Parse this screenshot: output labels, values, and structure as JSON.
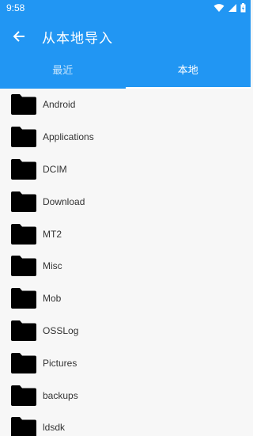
{
  "status_bar": {
    "time": "9:58"
  },
  "app_bar": {
    "title": "从本地导入",
    "back_icon": "arrow-left-icon"
  },
  "tabs": [
    {
      "label": "最近",
      "active": false
    },
    {
      "label": "本地",
      "active": true
    }
  ],
  "folders": [
    {
      "name": "Android"
    },
    {
      "name": "Applications"
    },
    {
      "name": "DCIM"
    },
    {
      "name": "Download"
    },
    {
      "name": "MT2"
    },
    {
      "name": "Misc"
    },
    {
      "name": "Mob"
    },
    {
      "name": "OSSLog"
    },
    {
      "name": "Pictures"
    },
    {
      "name": "backups"
    },
    {
      "name": "ldsdk"
    }
  ],
  "colors": {
    "primary": "#2196F3",
    "background": "#f7f7f7",
    "text": "#333333",
    "folder": "#000000"
  }
}
